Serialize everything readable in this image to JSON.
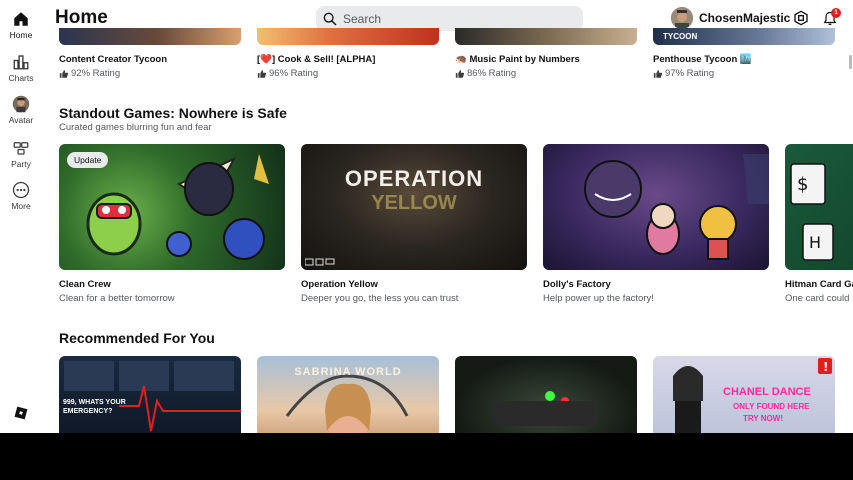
{
  "sidebar": {
    "items": [
      {
        "label": "Home",
        "icon": "home-icon"
      },
      {
        "label": "Charts",
        "icon": "charts-icon"
      },
      {
        "label": "Avatar",
        "icon": "avatar-icon"
      },
      {
        "label": "Party",
        "icon": "party-icon"
      },
      {
        "label": "More",
        "icon": "more-icon"
      }
    ]
  },
  "header": {
    "title": "Home",
    "search_placeholder": "Search",
    "username": "ChosenMajestic",
    "notification_count": "1"
  },
  "top_row": [
    {
      "name": "Content Creator Tycoon",
      "rating": "92% Rating"
    },
    {
      "name": "[❤️] Cook & Sell! [ALPHA]",
      "rating": "96% Rating"
    },
    {
      "name": "🦔 Music Paint by Numbers",
      "rating": "86% Rating"
    },
    {
      "name": "Penthouse Tycoon 🏙️",
      "rating": "97% Rating",
      "thumb_text": "TYCOON"
    }
  ],
  "standout": {
    "title": "Standout Games: Nowhere is Safe",
    "subtitle": "Curated games blurring fun and fear",
    "cards": [
      {
        "name": "Clean Crew",
        "desc": "Clean for a better tomorrow",
        "badge": "Update"
      },
      {
        "name": "Operation Yellow",
        "desc": "Deeper you go, the less you can trust",
        "thumb_text": "OPERATION",
        "thumb_text2": "YELLOW"
      },
      {
        "name": "Dolly's Factory",
        "desc": "Help power up the factory!"
      },
      {
        "name": "Hitman Card Ga",
        "desc": "One card could"
      }
    ]
  },
  "recommended": {
    "title": "Recommended For You",
    "cards": [
      {
        "thumb_text": "999, WHATS YOUR EMERGENCY?"
      },
      {
        "thumb_text": "SABRINA WORLD"
      },
      {
        "thumb_text": ""
      },
      {
        "thumb_text": "CHANEL DANCE",
        "thumb_text2": "ONLY FOUND HERE",
        "thumb_text3": "TRY NOW!"
      }
    ]
  },
  "colors": {
    "accent": "#e02020",
    "search_bg": "#e9eaeb",
    "muted_text": "#55595e"
  }
}
